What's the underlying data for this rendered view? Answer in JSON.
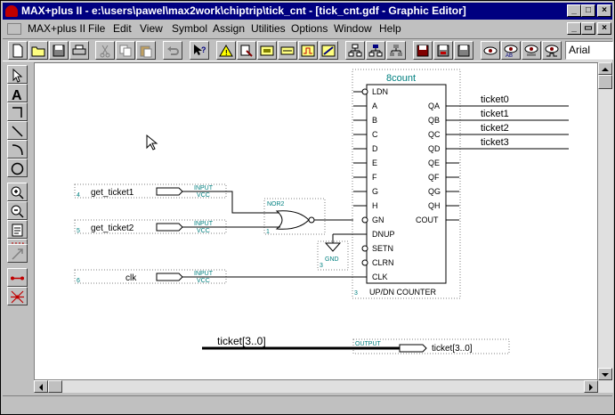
{
  "window": {
    "title": "MAX+plus II - e:\\users\\pawel\\max2work\\chiptrip\\tick_cnt - [tick_cnt.gdf - Graphic Editor]",
    "title_buttons": [
      "_",
      "□",
      "×"
    ],
    "doc_buttons": [
      "_",
      "▭",
      "×"
    ]
  },
  "menu": {
    "items": [
      "MAX+plus II",
      "File",
      "Edit",
      "View",
      "Symbol",
      "Assign",
      "Utilities",
      "Options",
      "Window",
      "Help"
    ]
  },
  "toolbar": {
    "font_name": "Arial",
    "buttons": [
      "new-file",
      "open-file",
      "save",
      "print",
      "cut",
      "copy",
      "paste",
      "undo",
      "help-pointer",
      "warning",
      "hierarchy-up",
      "hierarchy",
      "floorplan",
      "compiler",
      "simulator",
      "timing",
      "project-save-check",
      "project-save-compile",
      "project-save-simulate",
      "open-compile",
      "open-simulate",
      "open-timing",
      "open-waveform"
    ]
  },
  "palette": {
    "tools": [
      "selection-arrow",
      "text-tool",
      "orthogonal-line",
      "diagonal-line",
      "arc-tool",
      "circle-tool",
      "zoom-in",
      "zoom-out",
      "fit-page",
      "text-edit",
      "rubberband",
      "connect-dot",
      "node-connect"
    ]
  },
  "schematic": {
    "counter": {
      "name": "8count",
      "inputs": [
        "LDN",
        "A",
        "B",
        "C",
        "D",
        "E",
        "F",
        "G",
        "H",
        "GN",
        "DNUP",
        "SETN",
        "CLRN",
        "CLK"
      ],
      "outputs": [
        "QA",
        "QB",
        "QC",
        "QD",
        "QE",
        "QF",
        "QG",
        "QH",
        "COUT"
      ],
      "label": "UP/DN COUNTER",
      "instance": "3"
    },
    "nor_gate": {
      "label": "NOR2",
      "instance": "1"
    },
    "gnd": {
      "label": "GND",
      "instance": "3"
    },
    "input_pins": [
      {
        "name": "get_ticket1",
        "type": "INPUT",
        "vcc": "VCC",
        "instance": "4"
      },
      {
        "name": "get_ticket2",
        "type": "INPUT",
        "vcc": "VCC",
        "instance": "5"
      },
      {
        "name": "clk",
        "type": "INPUT",
        "vcc": "VCC",
        "instance": "6"
      }
    ],
    "output_nets": [
      "ticket0",
      "ticket1",
      "ticket2",
      "ticket3"
    ],
    "bus": {
      "name": "ticket[3..0]",
      "pin_type": "OUTPUT",
      "pin_name": "ticket[3..0]"
    }
  }
}
